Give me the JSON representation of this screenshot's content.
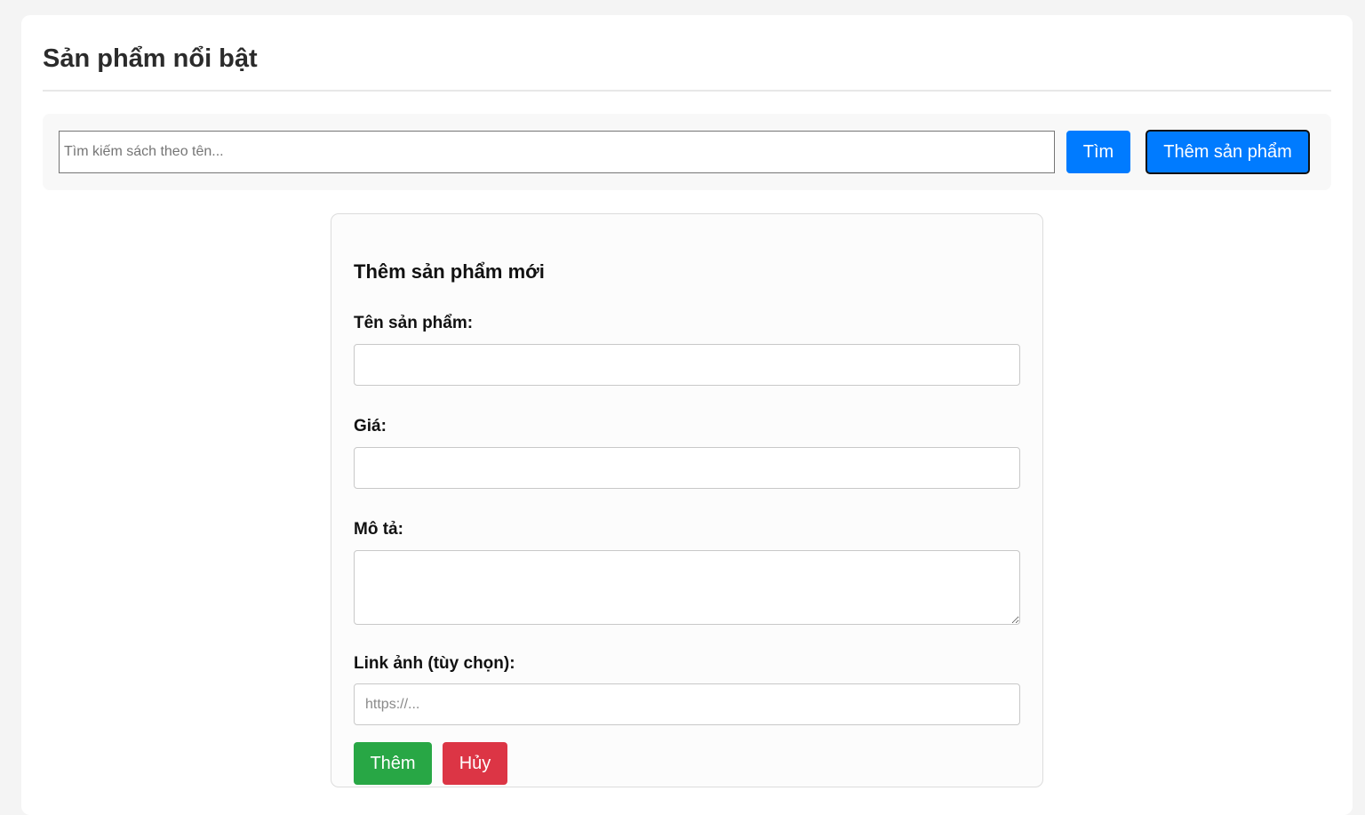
{
  "page": {
    "title": "Sản phẩm nổi bật"
  },
  "toolbar": {
    "search_placeholder": "Tìm kiếm sách theo tên...",
    "search_value": "",
    "search_label": "Tìm",
    "add_product_label": "Thêm sản phẩm"
  },
  "form": {
    "title": "Thêm sản phẩm mới",
    "name_label": "Tên sản phẩm:",
    "name_value": "",
    "price_label": "Giá:",
    "price_value": "",
    "description_label": "Mô tả:",
    "description_value": "",
    "image_label": "Link ảnh (tùy chọn):",
    "image_placeholder": "https://...",
    "image_value": "",
    "submit_label": "Thêm",
    "cancel_label": "Hủy"
  },
  "colors": {
    "primary": "#007bff",
    "success": "#28a745",
    "danger": "#dc3545"
  }
}
